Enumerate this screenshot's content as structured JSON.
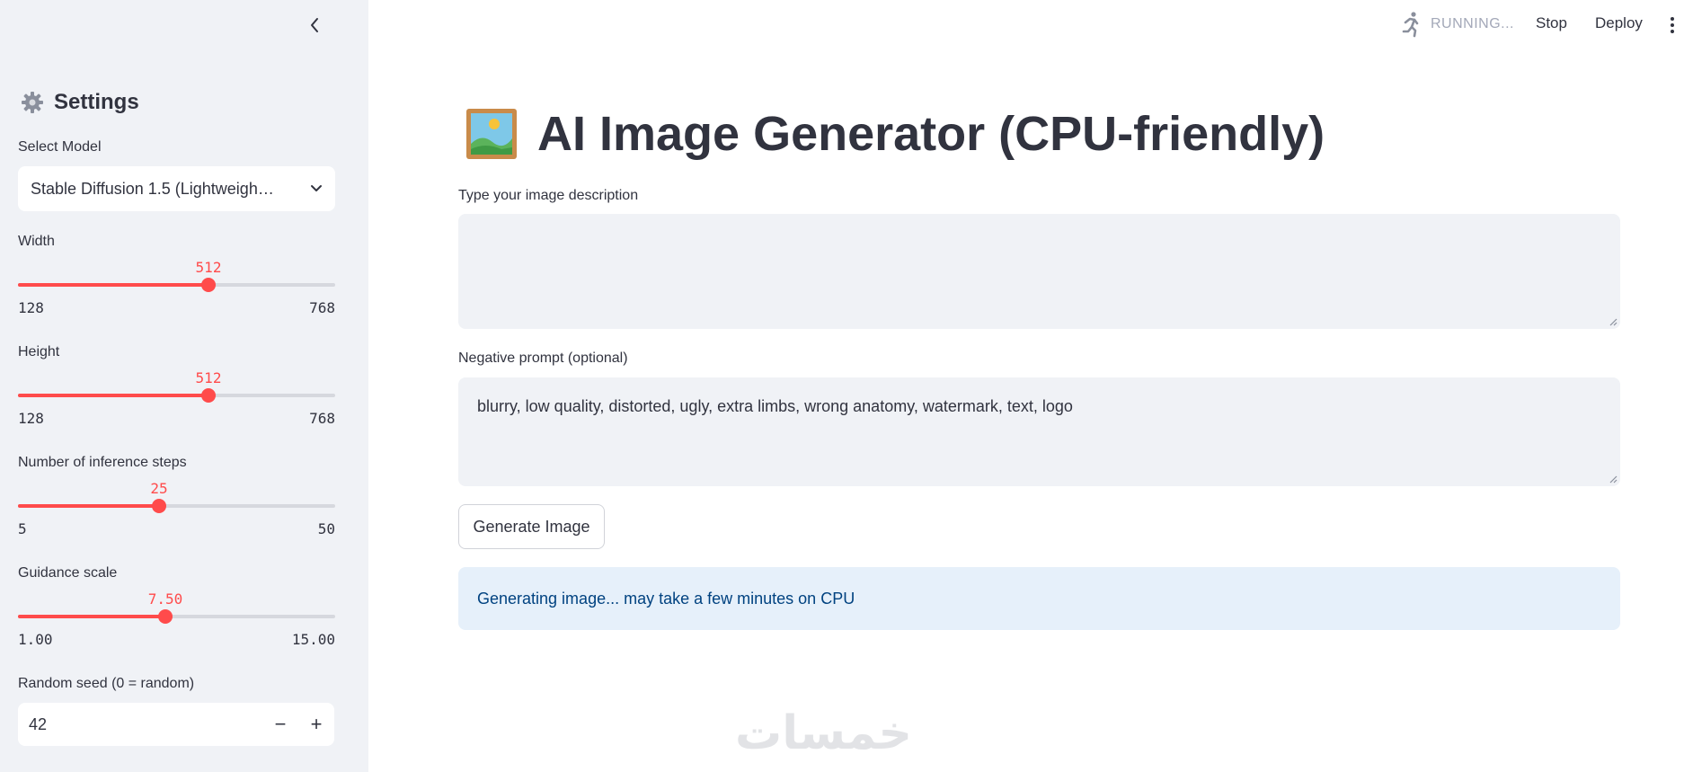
{
  "sidebar": {
    "settings_title": "Settings",
    "model": {
      "label": "Select Model",
      "value": "Stable Diffusion 1.5 (Lightweigh…"
    },
    "width": {
      "label": "Width",
      "value": "512",
      "min": "128",
      "max": "768",
      "fraction": 0.6
    },
    "height": {
      "label": "Height",
      "value": "512",
      "min": "128",
      "max": "768",
      "fraction": 0.6
    },
    "steps": {
      "label": "Number of inference steps",
      "value": "25",
      "min": "5",
      "max": "50",
      "fraction": 0.444
    },
    "guidance": {
      "label": "Guidance scale",
      "value": "7.50",
      "min": "1.00",
      "max": "15.00",
      "fraction": 0.464
    },
    "seed": {
      "label": "Random seed (0 = random)",
      "value": "42",
      "minus": "−",
      "plus": "+"
    }
  },
  "header": {
    "running": "RUNNING...",
    "stop": "Stop",
    "deploy": "Deploy"
  },
  "main": {
    "title": "AI Image Generator (CPU-friendly)",
    "prompt": {
      "label": "Type your image description",
      "value": ""
    },
    "negative": {
      "label": "Negative prompt (optional)",
      "value": "blurry, low quality, distorted, ugly, extra limbs, wrong anatomy, watermark, text, logo"
    },
    "generate_button": "Generate Image",
    "info": "Generating image... may take a few minutes on CPU"
  },
  "watermark": "خمسات",
  "colors": {
    "accent": "#ff4b4b",
    "sidebar_bg": "#f0f2f6",
    "info_bg": "#e6f0fa",
    "info_text": "#004280"
  }
}
